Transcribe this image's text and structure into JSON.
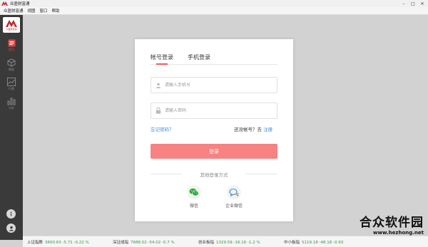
{
  "window": {
    "title": "众盈财富通",
    "controls": {
      "minimize": "–",
      "maximize": "□",
      "close": "✕"
    }
  },
  "menu": {
    "items": [
      "众盈财富通",
      "视图",
      "窗口",
      "帮助"
    ]
  },
  "sidebar": {
    "logo_text": "众盈财富通",
    "items": [
      {
        "label": "首页",
        "icon": "home-icon",
        "active": true
      },
      {
        "label": "数据",
        "icon": "cube-icon",
        "active": false
      },
      {
        "label": "行情",
        "icon": "chart-line-icon",
        "active": false
      },
      {
        "label": "分析",
        "icon": "bar-chart-icon",
        "active": false
      }
    ],
    "bottom": [
      "info-icon",
      "user-icon"
    ]
  },
  "login": {
    "tabs": {
      "account": "帐号登录",
      "phone": "手机登录"
    },
    "phone_placeholder": "请输入手机号",
    "password_placeholder": "请输入密码",
    "forgot": "忘记密码？",
    "no_account": "还没帐号？去 ",
    "register": "注册",
    "submit": "登录",
    "other_title": "其他登录方式",
    "wechat": "微信",
    "wecom": "企业微信",
    "accent_color": "#f78282",
    "link_color": "#3c8ed8"
  },
  "ticker": [
    {
      "name": "上证指数",
      "value": "3600.63 -5.71 -0.22 %"
    },
    {
      "name": "深证成指",
      "value": "7688.02 -54.02 -0.7 %"
    },
    {
      "name": "创业板指",
      "value": "1329.59 -16.16 -1.2 %"
    },
    {
      "name": "中小板指",
      "value": "5119.18 -48.18 -0.93"
    }
  ],
  "watermark": {
    "main": "合众软件园",
    "url": "www.hezhong.net"
  }
}
